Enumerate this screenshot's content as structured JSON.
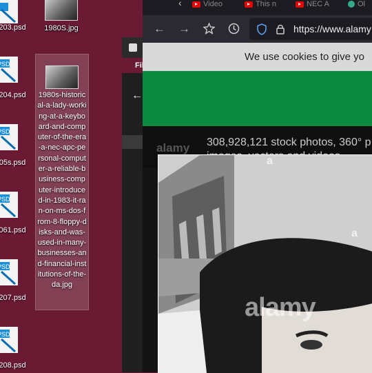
{
  "desktop": {
    "icons": [
      {
        "label": "203.psd"
      },
      {
        "label": "204.psd"
      },
      {
        "label": "05s.psd"
      },
      {
        "label": "061.psd"
      },
      {
        "label": "207.psd"
      },
      {
        "label": "208.psd"
      }
    ],
    "jpg_icon": {
      "label": "1980S.jpg"
    },
    "selected_file": {
      "label": "1980s-historical-a-lady-working-at-a-keyboard-and-computer-of-the-era-a-nec-apc-personal-computer-a-reliable-business-computer-introduced-in-1983-it-ran-on-ms-dos-from-8-floppy-disks-and-was-used-in-many-businesses-and-financial-institutions-of-the-da.jpg"
    }
  },
  "explorer": {
    "title": "Fil",
    "back_glyph": "←"
  },
  "browser": {
    "tabs": [
      {
        "label": "Video"
      },
      {
        "label": "This n"
      },
      {
        "label": "NEC A"
      },
      {
        "label": "Ol"
      }
    ],
    "address": "https://www.alamy",
    "page": {
      "cookie_banner": "We use cookies to give yo",
      "logo": "alamy",
      "stock_text": "308,928,121 stock photos, 360° p",
      "stock_text_line2": "images, vectors and videos",
      "watermark": "alamy",
      "watermark_small": "a"
    }
  }
}
